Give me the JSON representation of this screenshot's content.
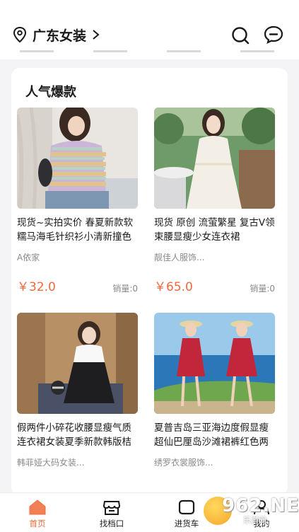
{
  "header": {
    "location": "广东女装",
    "icons": [
      "location-pin-icon",
      "chevron-right-icon",
      "search-icon",
      "message-icon"
    ]
  },
  "section": {
    "title": "人气爆款"
  },
  "products": [
    {
      "title": "现货~实拍实价 春夏新款软糯马海毛针织衫小清新撞色",
      "shop": "A依家",
      "price": "￥32.0",
      "sales": "销量:0"
    },
    {
      "title": "现货 原创 流萤繁星 复古V领束腰显瘦少女连衣裙",
      "shop": "靓佳人服饰...",
      "price": "￥65.0",
      "sales": "销量:0"
    },
    {
      "title": "假两件小碎花收腰显瘦气质连衣裙女装夏季新款韩版桔",
      "shop": "韩菲娅大码女装...",
      "price": "",
      "sales": ""
    },
    {
      "title": "夏普吉岛三亚海边度假显瘦超仙巴厘岛沙滩裙裤红色两",
      "shop": "绣罗衣裳服饰...",
      "price": "",
      "sales": ""
    }
  ],
  "tabbar": {
    "tabs": [
      {
        "label": "首页",
        "icon": "home-icon",
        "active": true
      },
      {
        "label": "找档口",
        "icon": "shop-icon",
        "active": false
      },
      {
        "label": "进货车",
        "icon": "cart-icon",
        "active": false
      },
      {
        "label": "我的",
        "icon": "profile-icon",
        "active": false
      }
    ],
    "active_color": "#f06a3a"
  },
  "watermark": {
    "number": "962",
    "domain": ".NET",
    "sub": "乐游网"
  },
  "colors": {
    "price": "#f2683d",
    "accent": "#f06a3a",
    "panel_bg": "#f4f4f6"
  }
}
